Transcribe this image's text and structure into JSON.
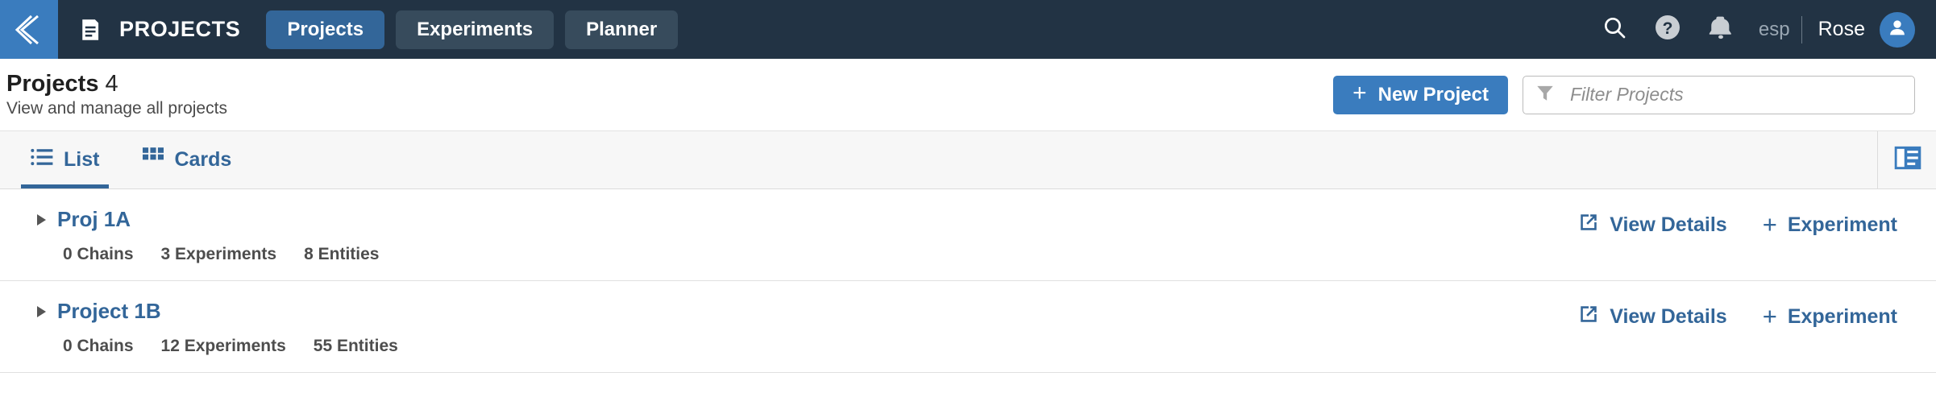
{
  "colors": {
    "nav_bg": "#223344",
    "accent_blue": "#3a7cbe",
    "link_blue": "#336699",
    "tab_inactive": "#374b5c",
    "page_bg": "#ffffff",
    "viewbar_bg": "#f7f7f7"
  },
  "topnav": {
    "collapse_icon": "chevron-left-icon",
    "brand_icon": "document-list-icon",
    "brand": "PROJECTS",
    "tabs": [
      {
        "label": "Projects",
        "active": true
      },
      {
        "label": "Experiments",
        "active": false
      },
      {
        "label": "Planner",
        "active": false
      }
    ],
    "icons": [
      {
        "name": "search-icon"
      },
      {
        "name": "help-circle-icon"
      },
      {
        "name": "bell-icon"
      }
    ],
    "language": "esp",
    "separator": "|",
    "user": "Rose",
    "avatar_icon": "user-avatar-icon"
  },
  "titlebar": {
    "title": "Projects",
    "count": "4",
    "subtitle": "View and manage all projects",
    "new_project_label": "New Project",
    "new_project_plus": "+",
    "filter_icon": "funnel-icon",
    "filter_placeholder": "Filter Projects",
    "filter_value": ""
  },
  "viewbar": {
    "tabs": [
      {
        "label": "List",
        "icon": "list-icon",
        "active": true
      },
      {
        "label": "Cards",
        "icon": "grid-icon",
        "active": false
      }
    ],
    "panel_toggle_icon": "side-panel-icon"
  },
  "list": {
    "view_details_label": "View Details",
    "view_details_icon": "external-link-icon",
    "add_experiment_label": "Experiment",
    "add_experiment_plus": "+",
    "caret_icon": "caret-right-icon",
    "rows": [
      {
        "name": "Proj 1A",
        "chains": "0 Chains",
        "experiments": "3 Experiments",
        "entities": "8 Entities"
      },
      {
        "name": "Project 1B",
        "chains": "0 Chains",
        "experiments": "12 Experiments",
        "entities": "55 Entities"
      }
    ]
  }
}
